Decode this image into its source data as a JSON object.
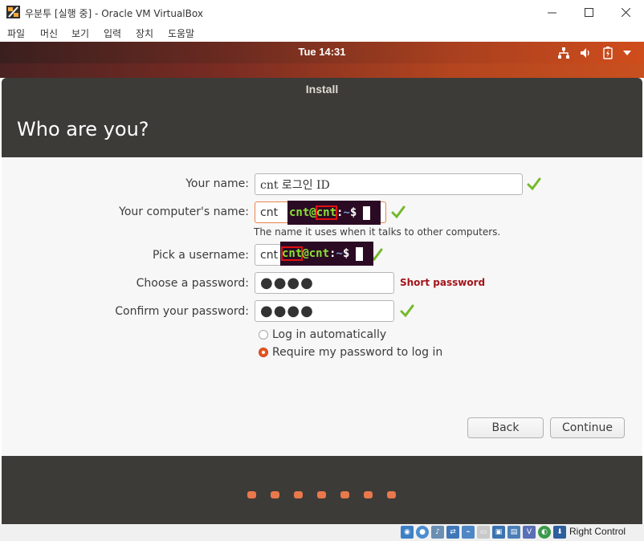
{
  "window": {
    "title": "우분투 [실행 중] - Oracle VM VirtualBox",
    "minimize_glyph": "—",
    "maximize_glyph": "☐",
    "close_glyph": "✕"
  },
  "menu": [
    "파일",
    "머신",
    "보기",
    "입력",
    "장치",
    "도움말"
  ],
  "top_panel": {
    "clock": "Tue 14:31",
    "icons": [
      "network-icon",
      "volume-icon",
      "battery-icon",
      "dropdown-arrow-icon"
    ]
  },
  "dialog": {
    "title": "Install",
    "heading": "Who are you?"
  },
  "form": {
    "name_label": "Your name:",
    "name_value": "cnt  로그인 ID",
    "computer_label": "Your computer's name:",
    "computer_value": "cnt",
    "computer_hint": "The name it uses when it talks to other computers.",
    "username_label": "Pick a username:",
    "username_value": "cnt",
    "password_label": "Choose a password:",
    "password_value": "●●●●",
    "password_strength": "Short password",
    "confirm_label": "Confirm your password:",
    "confirm_value": "●●●●",
    "login_auto_label": "Log in automatically",
    "require_password_label": "Require my password to log in",
    "selected_login_option": "Require my password to log in"
  },
  "terminal_overlays": [
    {
      "user": "cnt",
      "at": "@",
      "host": "cnt",
      "colon": ":",
      "path": "~",
      "prompt": "$",
      "highlighted": "host"
    },
    {
      "user": "cnt",
      "at": "@",
      "host": "cnt",
      "colon": ":",
      "path": "~",
      "prompt": "$",
      "highlighted": "user"
    }
  ],
  "buttons": {
    "back": "Back",
    "continue": "Continue"
  },
  "progress": {
    "total_steps": 7
  },
  "statusbar": {
    "host_key": "Right Control"
  },
  "colors": {
    "accent": "#e95420",
    "check": "#73b92b",
    "error": "#a3141a",
    "dialog_dark": "#3c3b37"
  }
}
